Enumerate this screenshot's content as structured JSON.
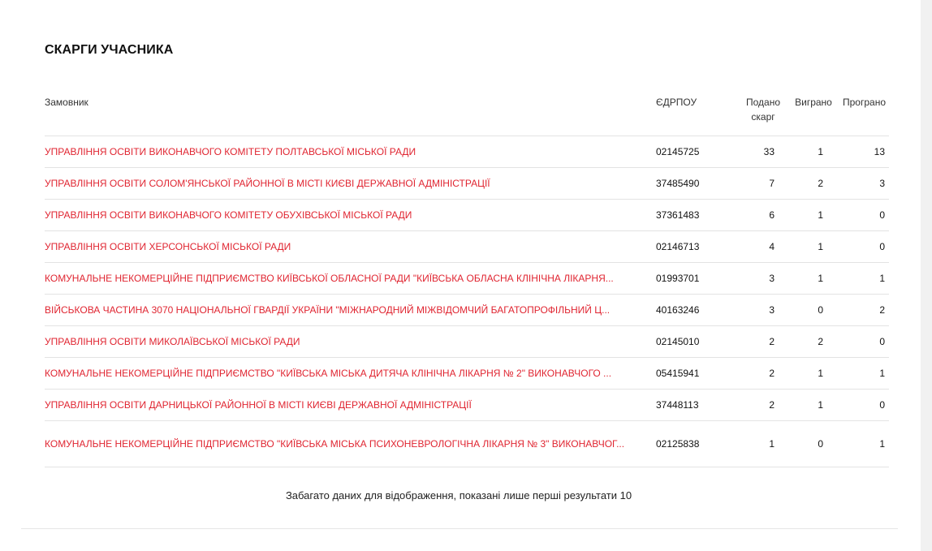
{
  "section": {
    "title": "СКАРГИ УЧАСНИКА"
  },
  "table": {
    "headers": {
      "customer": "Замовник",
      "code": "ЄДРПОУ",
      "filed": "Подано скарг",
      "won": "Виграно",
      "lost": "Програно"
    },
    "rows": [
      {
        "customer": "УПРАВЛІННЯ ОСВІТИ ВИКОНАВЧОГО КОМІТЕТУ ПОЛТАВСЬКОЇ МІСЬКОЇ РАДИ",
        "code": "02145725",
        "filed": "33",
        "won": "1",
        "lost": "13"
      },
      {
        "customer": "УПРАВЛІННЯ ОСВІТИ СОЛОМ'ЯНСЬКОЇ РАЙОННОЇ В МІСТІ КИЄВІ ДЕРЖАВНОЇ АДМІНІСТРАЦІЇ",
        "code": "37485490",
        "filed": "7",
        "won": "2",
        "lost": "3"
      },
      {
        "customer": "УПРАВЛІННЯ ОСВІТИ ВИКОНАВЧОГО КОМІТЕТУ ОБУХІВСЬКОЇ МІСЬКОЇ РАДИ",
        "code": "37361483",
        "filed": "6",
        "won": "1",
        "lost": "0"
      },
      {
        "customer": "УПРАВЛІННЯ ОСВІТИ ХЕРСОНСЬКОЇ МІСЬКОЇ РАДИ",
        "code": "02146713",
        "filed": "4",
        "won": "1",
        "lost": "0"
      },
      {
        "customer": "КОМУНАЛЬНЕ НЕКОМЕРЦІЙНЕ ПІДПРИЄМСТВО КИЇВСЬКОЇ ОБЛАСНОЇ РАДИ \"КИЇВСЬКА ОБЛАСНА КЛІНІЧНА ЛІКАРНЯ...",
        "code": "01993701",
        "filed": "3",
        "won": "1",
        "lost": "1"
      },
      {
        "customer": "ВІЙСЬКОВА ЧАСТИНА 3070 НАЦІОНАЛЬНОЇ ГВАРДІЇ УКРАЇНИ \"МІЖНАРОДНИЙ МІЖВІДОМЧИЙ БАГАТОПРОФІЛЬНИЙ Ц...",
        "code": "40163246",
        "filed": "3",
        "won": "0",
        "lost": "2"
      },
      {
        "customer": "УПРАВЛІННЯ ОСВІТИ МИКОЛАЇВСЬКОЇ МІСЬКОЇ РАДИ",
        "code": "02145010",
        "filed": "2",
        "won": "2",
        "lost": "0"
      },
      {
        "customer": "КОМУНАЛЬНЕ НЕКОМЕРЦІЙНЕ ПІДПРИЄМСТВО \"КИЇВСЬКА МІСЬКА ДИТЯЧА КЛІНІЧНА ЛІКАРНЯ № 2\" ВИКОНАВЧОГО ...",
        "code": "05415941",
        "filed": "2",
        "won": "1",
        "lost": "1"
      },
      {
        "customer": "УПРАВЛІННЯ ОСВІТИ ДАРНИЦЬКОЇ РАЙОННОЇ В МІСТІ КИЄВІ ДЕРЖАВНОЇ АДМІНІСТРАЦІЇ",
        "code": "37448113",
        "filed": "2",
        "won": "1",
        "lost": "0"
      },
      {
        "customer": "КОМУНАЛЬНЕ НЕКОМЕРЦІЙНЕ ПІДПРИЄМСТВО \"КИЇВСЬКА МІСЬКА ПСИХОНЕВРОЛОГІЧНА ЛІКАРНЯ № 3\" ВИКОНАВЧОГ...",
        "code": "02125838",
        "filed": "1",
        "won": "0",
        "lost": "1"
      }
    ]
  },
  "footer": {
    "notice": "Забагато даних для відображення, показані лише перші результати 10"
  },
  "colors": {
    "link": "#e02531",
    "divider": "#e3e3e3"
  }
}
